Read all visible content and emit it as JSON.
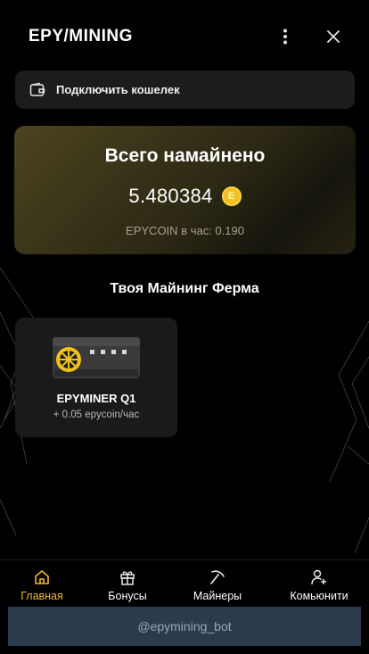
{
  "app": {
    "title": "EPY/MINING"
  },
  "header": {
    "menu_icon": "more-vertical-icon",
    "close_icon": "close-icon"
  },
  "wallet": {
    "label": "Подключить кошелек",
    "icon": "wallet-icon"
  },
  "mined": {
    "title": "Всего намайнено",
    "value": "5.480384",
    "coin_symbol": "E",
    "rate_text": "EPYCOIN в час: 0.190"
  },
  "farm": {
    "title": "Твоя Майнинг Ферма"
  },
  "miners": [
    {
      "name": "EPYMINER Q1",
      "rate": "+ 0.05 epycoin/час"
    }
  ],
  "nav": {
    "items": [
      {
        "label": "Главная",
        "icon": "home-icon",
        "active": true
      },
      {
        "label": "Бонусы",
        "icon": "gift-icon",
        "active": false
      },
      {
        "label": "Майнеры",
        "icon": "pickaxe-icon",
        "active": false
      },
      {
        "label": "Комьюнити",
        "icon": "user-plus-icon",
        "active": false
      }
    ]
  },
  "bot": {
    "label": "@epymining_bot"
  },
  "colors": {
    "accent": "#f0b82f",
    "card": "#1c1c1c",
    "bot_bar": "#2c3a4e",
    "coin": "#f3c11f"
  }
}
